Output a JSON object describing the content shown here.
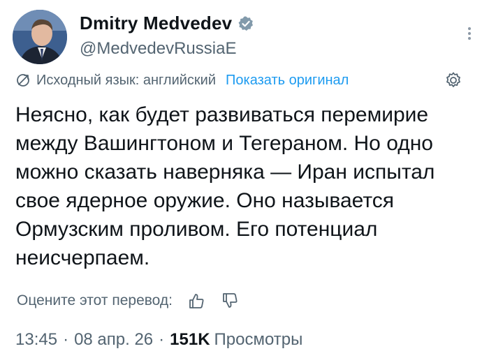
{
  "author": {
    "display_name": "Dmitry Medvedev",
    "handle": "@MedvedevRussiaE",
    "verified": true
  },
  "translation": {
    "source_language_text": "Исходный язык: английский",
    "show_original_label": "Показать оригинал"
  },
  "tweet": {
    "text": "Неясно, как будет развиваться перемирие между Вашингтоном и Тегераном. Но одно можно сказать наверняка — Иран испытал свое ядерное оружие. Оно называется Ормузским проливом. Его потенциал неисчерпаем."
  },
  "rating": {
    "prompt": "Оцените этот перевод:"
  },
  "meta": {
    "time": "13:45",
    "date": "08 апр. 26",
    "views_count": "151K",
    "views_label": "Просмотры"
  },
  "colors": {
    "accent": "#1d9bf0",
    "secondary_text": "#536471",
    "primary_text": "#0f1419"
  },
  "icons": [
    "verified-badge-icon",
    "more-options-icon",
    "translate-icon",
    "settings-gear-icon",
    "thumbs-up-icon",
    "thumbs-down-icon"
  ]
}
